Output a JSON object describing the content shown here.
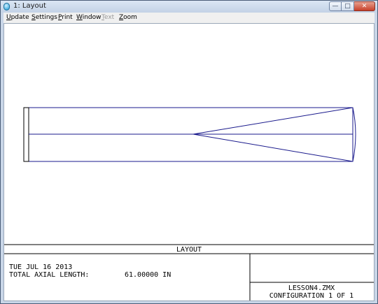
{
  "window": {
    "title": "1: Layout",
    "controls": {
      "minimize": "—",
      "maximize": "□",
      "close": "✕"
    }
  },
  "menu": {
    "items": [
      {
        "label_first": "U",
        "label_rest": "pdate",
        "enabled": true
      },
      {
        "label_first": "S",
        "label_rest": "ettings",
        "enabled": true
      },
      {
        "label_first": "P",
        "label_rest": "rint",
        "enabled": true
      },
      {
        "label_first": "W",
        "label_rest": "indow",
        "enabled": true
      },
      {
        "label_first": "T",
        "label_rest": "ext",
        "enabled": false
      },
      {
        "label_first": "Z",
        "label_rest": "oom",
        "enabled": true
      }
    ]
  },
  "plot": {
    "line_color": "#1a1a8c",
    "frame_color": "#000000"
  },
  "info": {
    "section_title": "LAYOUT",
    "date": "TUE JUL 16 2013",
    "axial_length_label": "TOTAL AXIAL LENGTH:",
    "axial_length_value": "61.00000 IN",
    "filename": "LESSON4.ZMX",
    "configuration": "CONFIGURATION 1 OF 1"
  }
}
